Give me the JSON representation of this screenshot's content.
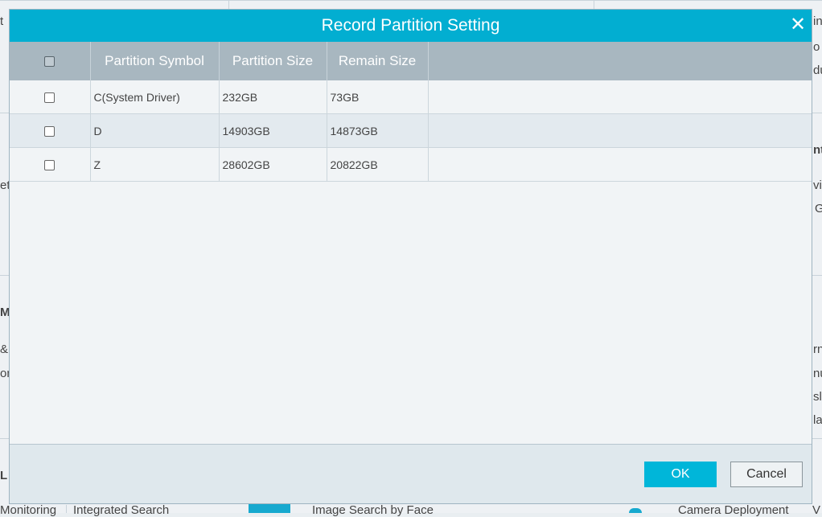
{
  "background": {
    "left_fragments": [
      "t",
      "ett",
      "Ma",
      "&",
      "on",
      "L"
    ],
    "right_fragments": [
      "in",
      "o",
      "du",
      "nt",
      "vi",
      "G",
      "rn",
      "nu",
      "sl",
      "la",
      "V"
    ],
    "bottom_fragments": [
      "Monitoring",
      "Integrated Search",
      "Image Search by Face",
      "Camera Deployment"
    ]
  },
  "dialog": {
    "title": "Record Partition Setting",
    "columns": [
      "Partition Symbol",
      "Partition Size",
      "Remain Size"
    ],
    "rows": [
      {
        "symbol": "C(System Driver)",
        "size": "232GB",
        "remain": "73GB"
      },
      {
        "symbol": "D",
        "size": "14903GB",
        "remain": "14873GB"
      },
      {
        "symbol": "Z",
        "size": "28602GB",
        "remain": "20822GB"
      }
    ],
    "ok_label": "OK",
    "cancel_label": "Cancel"
  },
  "colors": {
    "accent": "#02aed1",
    "header": "#a8b7c0"
  }
}
